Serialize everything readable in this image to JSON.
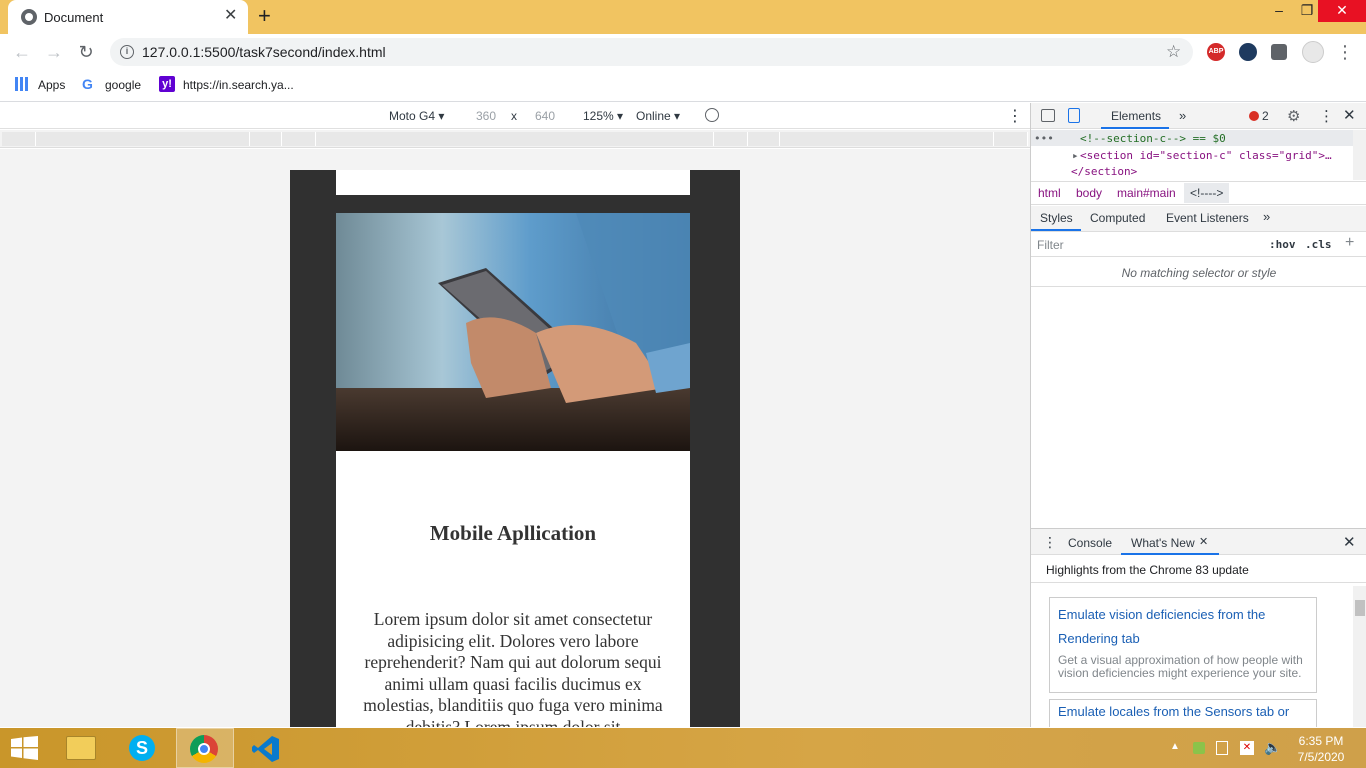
{
  "browser": {
    "tab_title": "Document",
    "tab_close": "✕",
    "new_tab": "+",
    "window_minimize": "–",
    "window_maximize": "❐",
    "window_close": "✕",
    "url": "127.0.0.1:5500/task7second/index.html"
  },
  "bookmarks": {
    "apps": "Apps",
    "google": "google",
    "yahoo": "https://in.search.ya..."
  },
  "device_toolbar": {
    "device": "Moto G4",
    "width": "360",
    "times": "x",
    "height": "640",
    "zoom": "125%",
    "network": "Online"
  },
  "page": {
    "title": "Mobile Apllication",
    "body": "Lorem ipsum dolor sit amet consectetur adipisicing elit. Dolores vero labore reprehenderit? Nam qui aut dolorum sequi animi ullam quasi facilis ducimus ex molestias, blanditiis quo fuga vero minima debitis? Lorem ipsum dolor sit"
  },
  "devtools": {
    "tab_elements": "Elements",
    "error_count": "2",
    "dom_line1": "<!--section-c--> == $0",
    "dom_line2": "<section id=\"section-c\" class=\"grid\">…",
    "dom_line3": "</section>",
    "breadcrumbs": [
      "html",
      "body",
      "main#main",
      "<!---->"
    ],
    "sub_tabs": [
      "Styles",
      "Computed",
      "Event Listeners"
    ],
    "filter_placeholder": "Filter",
    "hov": ":hov",
    "cls": ".cls",
    "no_match": "No matching selector or style",
    "drawer_console": "Console",
    "drawer_whatsnew": "What's New",
    "highlights": "Highlights from the Chrome 83 update",
    "news1_title_line1": "Emulate vision deficiencies from the",
    "news1_title_line2": "Rendering tab",
    "news1_desc": "Get a visual approximation of how people with vision deficiencies might experience your site.",
    "news2_title": "Emulate locales from the Sensors tab or"
  },
  "taskbar": {
    "time": "6:35 PM",
    "date": "7/5/2020"
  },
  "colors": {
    "titlebar": "#f1c461",
    "close_red": "#e81123",
    "devtools_blue": "#1a73e8",
    "link_blue": "#1a5fb4"
  }
}
